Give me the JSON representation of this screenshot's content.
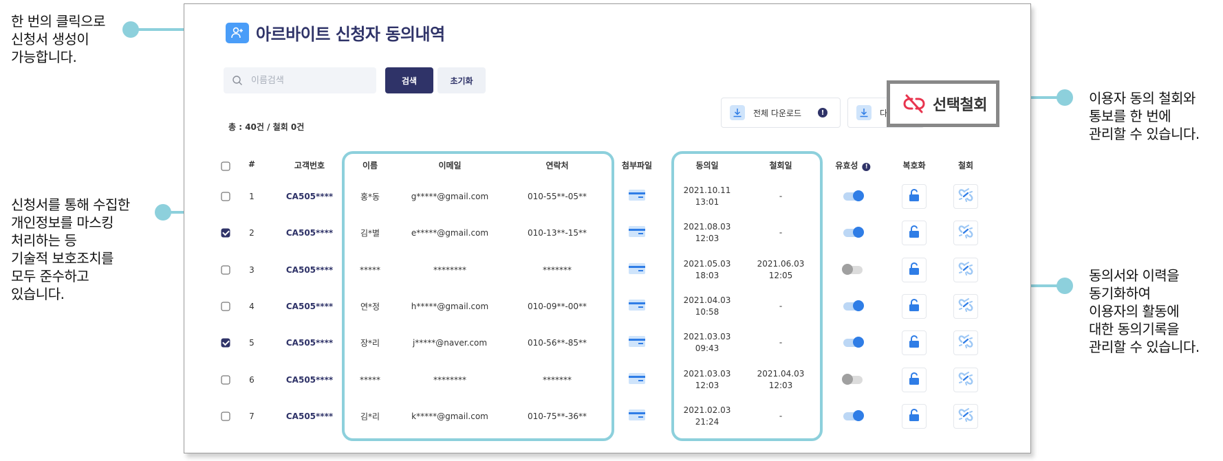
{
  "notes": {
    "top_left": "한 번의 클릭으로\n신청서 생성이\n가능합니다.",
    "mid_left": "신청서를 통해 수집한\n개인정보를 마스킹\n처리하는 등\n기술적 보호조치를\n모두 준수하고\n있습니다.",
    "top_right": "이용자 동의 철회와\n통보를 한 번에\n관리할 수 있습니다.",
    "mid_right": "동의서와 이력을\n동기화하여\n이용자의 활동에\n대한 동의기록을\n관리할 수 있습니다."
  },
  "colors": {
    "accent": "#8dd0dc",
    "navy": "#2f3368",
    "blue": "#4a9df8",
    "danger": "#e8344e"
  },
  "app": {
    "title": "아르바이트 신청자 동의내역",
    "title_icon": "user-add-icon"
  },
  "search": {
    "placeholder": "이름검색",
    "search_label": "검색",
    "reset_label": "초기화"
  },
  "downloads": {
    "all_label": "전체 다운로드",
    "selected_label_visible": "다",
    "info_mark": "!"
  },
  "callout": {
    "label": "선택철회",
    "icon": "unlink-icon"
  },
  "summary": {
    "total_text": "총 : 40건 / 철회 0건"
  },
  "table": {
    "headers": {
      "num": "#",
      "customer_no": "고객번호",
      "name": "이름",
      "email": "이메일",
      "phone": "연락처",
      "attachment": "첨부파일",
      "consent_date": "동의일",
      "withdraw_date": "철회일",
      "validity": "유효성",
      "decrypt": "복호화",
      "withdraw": "철회"
    },
    "rows": [
      {
        "checked": false,
        "num": "1",
        "customer_no": "CA505****",
        "name": "홍*동",
        "email": "g*****@gmail.com",
        "phone": "010-55**-05**",
        "consent_date": "2021.10.11",
        "consent_time": "13:01",
        "withdraw_date": "-",
        "withdraw_time": "",
        "valid": true
      },
      {
        "checked": true,
        "num": "2",
        "customer_no": "CA505****",
        "name": "김*별",
        "email": "e*****@gmail.com",
        "phone": "010-13**-15**",
        "consent_date": "2021.08.03",
        "consent_time": "12:03",
        "withdraw_date": "-",
        "withdraw_time": "",
        "valid": true
      },
      {
        "checked": false,
        "num": "3",
        "customer_no": "CA505****",
        "name": "*****",
        "email": "********",
        "phone": "*******",
        "consent_date": "2021.05.03",
        "consent_time": "18:03",
        "withdraw_date": "2021.06.03",
        "withdraw_time": "12:05",
        "valid": false
      },
      {
        "checked": false,
        "num": "4",
        "customer_no": "CA505****",
        "name": "연*정",
        "email": "h*****@gmail.com",
        "phone": "010-09**-00**",
        "consent_date": "2021.04.03",
        "consent_time": "10:58",
        "withdraw_date": "-",
        "withdraw_time": "",
        "valid": true
      },
      {
        "checked": true,
        "num": "5",
        "customer_no": "CA505****",
        "name": "장*리",
        "email": "j*****@naver.com",
        "phone": "010-56**-85**",
        "consent_date": "2021.03.03",
        "consent_time": "09:43",
        "withdraw_date": "-",
        "withdraw_time": "",
        "valid": true
      },
      {
        "checked": false,
        "num": "6",
        "customer_no": "CA505****",
        "name": "*****",
        "email": "********",
        "phone": "*******",
        "consent_date": "2021.03.03",
        "consent_time": "12:03",
        "withdraw_date": "2021.04.03",
        "withdraw_time": "12:03",
        "valid": false
      },
      {
        "checked": false,
        "num": "7",
        "customer_no": "CA505****",
        "name": "김*리",
        "email": "k*****@gmail.com",
        "phone": "010-75**-36**",
        "consent_date": "2021.02.03",
        "consent_time": "21:24",
        "withdraw_date": "-",
        "withdraw_time": "",
        "valid": true
      }
    ]
  }
}
